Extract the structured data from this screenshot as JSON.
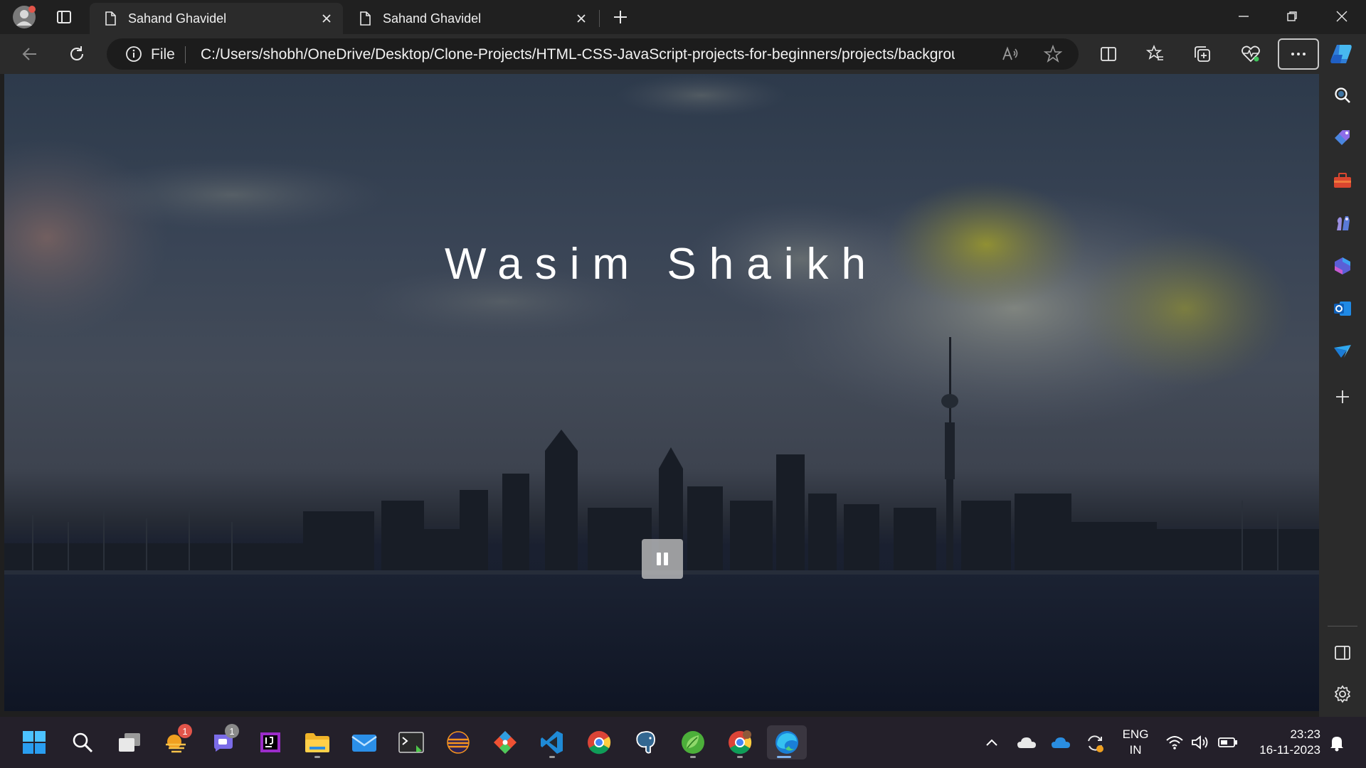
{
  "browser": {
    "tabs": [
      {
        "title": "Sahand Ghavidel",
        "active": true
      },
      {
        "title": "Sahand Ghavidel",
        "active": false
      }
    ],
    "address": {
      "scheme_label": "File",
      "url": "C:/Users/shobh/OneDrive/Desktop/Clone-Projects/HTML-CSS-JavaScript-projects-for-beginners/projects/background..."
    },
    "accent_color": "#2f7ed8"
  },
  "page": {
    "title": "Wasim Shaikh",
    "video_state": "playing",
    "control_icon": "pause-icon"
  },
  "sidebar": {
    "items": [
      "search-icon",
      "shopping-tag-icon",
      "tools-icon",
      "games-icon",
      "microsoft365-icon",
      "outlook-icon",
      "telegram-icon",
      "add-icon"
    ],
    "bottom": [
      "split-sidebar-icon",
      "settings-icon"
    ]
  },
  "taskbar": {
    "apps": [
      {
        "name": "start",
        "badge": ""
      },
      {
        "name": "search",
        "badge": ""
      },
      {
        "name": "task-view",
        "badge": ""
      },
      {
        "name": "widgets",
        "badge": "1"
      },
      {
        "name": "teams-chat",
        "badge": "1"
      },
      {
        "name": "intellij-idea",
        "badge": ""
      },
      {
        "name": "file-explorer",
        "badge": ""
      },
      {
        "name": "mail",
        "badge": ""
      },
      {
        "name": "terminal",
        "badge": ""
      },
      {
        "name": "eclipse",
        "badge": ""
      },
      {
        "name": "git",
        "badge": ""
      },
      {
        "name": "vscode",
        "badge": ""
      },
      {
        "name": "chrome",
        "badge": ""
      },
      {
        "name": "postgresql",
        "badge": ""
      },
      {
        "name": "spring-tools",
        "badge": ""
      },
      {
        "name": "chrome-profile",
        "badge": ""
      },
      {
        "name": "edge",
        "badge": ""
      }
    ],
    "tray": {
      "language_line1": "ENG",
      "language_line2": "IN",
      "time": "23:23",
      "date": "16-11-2023"
    }
  }
}
